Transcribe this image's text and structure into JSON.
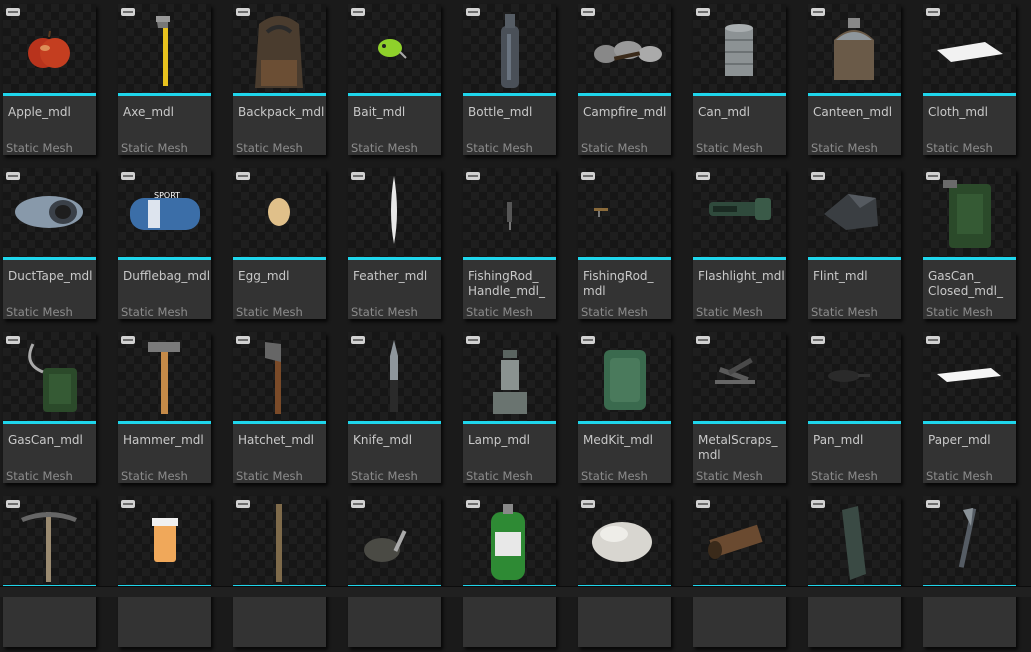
{
  "assets": [
    {
      "name": "Apple_mdl",
      "type": "Static Mesh",
      "icon": "apple-icon"
    },
    {
      "name": "Axe_mdl",
      "type": "Static Mesh",
      "icon": "axe-icon"
    },
    {
      "name": "Backpack_mdl",
      "type": "Static Mesh",
      "icon": "backpack-icon"
    },
    {
      "name": "Bait_mdl",
      "type": "Static Mesh",
      "icon": "bait-icon"
    },
    {
      "name": "Bottle_mdl",
      "type": "Static Mesh",
      "icon": "bottle-icon"
    },
    {
      "name": "Campfire_mdl",
      "type": "Static Mesh",
      "icon": "campfire-icon"
    },
    {
      "name": "Can_mdl",
      "type": "Static Mesh",
      "icon": "can-icon"
    },
    {
      "name": "Canteen_mdl",
      "type": "Static Mesh",
      "icon": "canteen-icon"
    },
    {
      "name": "Cloth_mdl",
      "type": "Static Mesh",
      "icon": "cloth-icon"
    },
    {
      "name": "DuctTape_mdl",
      "type": "Static Mesh",
      "icon": "duct-tape-icon"
    },
    {
      "name": "Dufflebag_mdl",
      "type": "Static Mesh",
      "icon": "duffle-bag-icon"
    },
    {
      "name": "Egg_mdl",
      "type": "Static Mesh",
      "icon": "egg-icon"
    },
    {
      "name": "Feather_mdl",
      "type": "Static Mesh",
      "icon": "feather-icon"
    },
    {
      "name": "FishingRod_\nHandle_mdl_",
      "type": "Static Mesh",
      "icon": "fishing-rod-handle-icon"
    },
    {
      "name": "FishingRod_\nmdl",
      "type": "Static Mesh",
      "icon": "fishing-rod-icon"
    },
    {
      "name": "Flashlight_mdl",
      "type": "Static Mesh",
      "icon": "flashlight-icon"
    },
    {
      "name": "Flint_mdl",
      "type": "Static Mesh",
      "icon": "flint-icon"
    },
    {
      "name": "GasCan_\nClosed_mdl_",
      "type": "Static Mesh",
      "icon": "gas-can-closed-icon"
    },
    {
      "name": "GasCan_mdl",
      "type": "Static Mesh",
      "icon": "gas-can-icon"
    },
    {
      "name": "Hammer_mdl",
      "type": "Static Mesh",
      "icon": "hammer-icon"
    },
    {
      "name": "Hatchet_mdl",
      "type": "Static Mesh",
      "icon": "hatchet-icon"
    },
    {
      "name": "Knife_mdl",
      "type": "Static Mesh",
      "icon": "knife-icon"
    },
    {
      "name": "Lamp_mdl",
      "type": "Static Mesh",
      "icon": "lamp-icon"
    },
    {
      "name": "MedKit_mdl",
      "type": "Static Mesh",
      "icon": "medkit-icon"
    },
    {
      "name": "MetalScraps_\nmdl",
      "type": "Static Mesh",
      "icon": "metal-scraps-icon"
    },
    {
      "name": "Pan_mdl",
      "type": "Static Mesh",
      "icon": "pan-icon"
    },
    {
      "name": "Paper_mdl",
      "type": "Static Mesh",
      "icon": "paper-icon"
    },
    {
      "name": "",
      "type": "",
      "icon": "pickaxe-icon"
    },
    {
      "name": "",
      "type": "",
      "icon": "pill-bottle-icon"
    },
    {
      "name": "",
      "type": "",
      "icon": "stick-icon"
    },
    {
      "name": "",
      "type": "",
      "icon": "pot-icon"
    },
    {
      "name": "",
      "type": "",
      "icon": "propane-tank-icon"
    },
    {
      "name": "",
      "type": "",
      "icon": "rock-icon"
    },
    {
      "name": "",
      "type": "",
      "icon": "pipe-icon"
    },
    {
      "name": "",
      "type": "",
      "icon": "shard-icon"
    },
    {
      "name": "",
      "type": "",
      "icon": "tool-icon"
    }
  ],
  "colors": {
    "accent": "#1fd6ec",
    "tile_body": "#333333",
    "background": "#1a1a1a"
  }
}
